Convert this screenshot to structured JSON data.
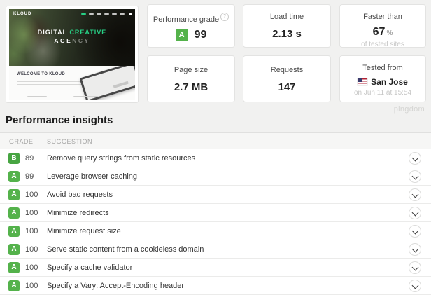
{
  "page": {
    "watermark": "pingdom"
  },
  "thumbnail": {
    "site_name": "KLOUD",
    "hero_word1": "DIGITAL ",
    "hero_word2": "CREATIVE",
    "hero_word3": "AGE",
    "hero_word4": "NCY",
    "welcome_heading": "WELCOME TO KLOUD"
  },
  "summary_cards": [
    {
      "label": "Performance grade",
      "grade": "A",
      "value": "99",
      "help_glyph": "?"
    },
    {
      "label": "Load time",
      "value": "2.13 s"
    },
    {
      "label": "Faster than",
      "value": "67",
      "unit": "%",
      "subtext": "of tested sites"
    },
    {
      "label": "Page size",
      "value": "2.7 MB"
    },
    {
      "label": "Requests",
      "value": "147"
    },
    {
      "label": "Tested from",
      "value": "San Jose",
      "subtext": "on Jun 11 at 15:54",
      "flag": "us-flag"
    }
  ],
  "insights": {
    "title": "Performance insights",
    "columns": [
      "GRADE",
      "SUGGESTION"
    ],
    "rows": [
      {
        "grade": "B",
        "score": "89",
        "suggestion": "Remove query strings from static resources"
      },
      {
        "grade": "A",
        "score": "99",
        "suggestion": "Leverage browser caching"
      },
      {
        "grade": "A",
        "score": "100",
        "suggestion": "Avoid bad requests"
      },
      {
        "grade": "A",
        "score": "100",
        "suggestion": "Minimize redirects"
      },
      {
        "grade": "A",
        "score": "100",
        "suggestion": "Minimize request size"
      },
      {
        "grade": "A",
        "score": "100",
        "suggestion": "Serve static content from a cookieless domain"
      },
      {
        "grade": "A",
        "score": "100",
        "suggestion": "Specify a cache validator"
      },
      {
        "grade": "A",
        "score": "100",
        "suggestion": "Specify a Vary: Accept-Encoding header"
      }
    ]
  },
  "colors": {
    "grade_a": "#54b24b",
    "grade_b": "#47a542",
    "hero_accent": "#27cf85"
  }
}
